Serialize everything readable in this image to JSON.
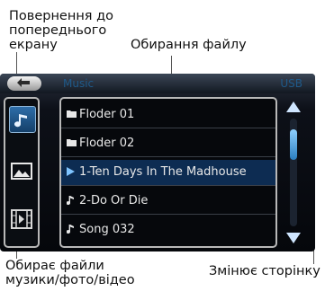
{
  "callouts": {
    "back": "Повернення до попереднього екрану",
    "file_select": "Обирання файлу",
    "media_select": "Обирає файли музики/фото/відео",
    "page_change": "Змінює сторінку"
  },
  "topbar": {
    "title": "Music",
    "source": "USB"
  },
  "side": {
    "items": [
      {
        "icon": "music-note-icon",
        "active": true
      },
      {
        "icon": "photo-icon",
        "active": false
      },
      {
        "icon": "video-icon",
        "active": false
      }
    ]
  },
  "files": [
    {
      "icon": "folder-icon",
      "label": "Floder 01"
    },
    {
      "icon": "folder-icon",
      "label": "Floder 02"
    },
    {
      "icon": "play-icon",
      "label": "1-Ten Days In The Madhouse",
      "selected": true
    },
    {
      "icon": "music-note-icon",
      "label": "2-Do Or Die"
    },
    {
      "icon": "music-note-icon",
      "label": "Song 032"
    }
  ],
  "colors": {
    "accent": "#2b7ec0",
    "selected_row": "#0d2c52"
  }
}
